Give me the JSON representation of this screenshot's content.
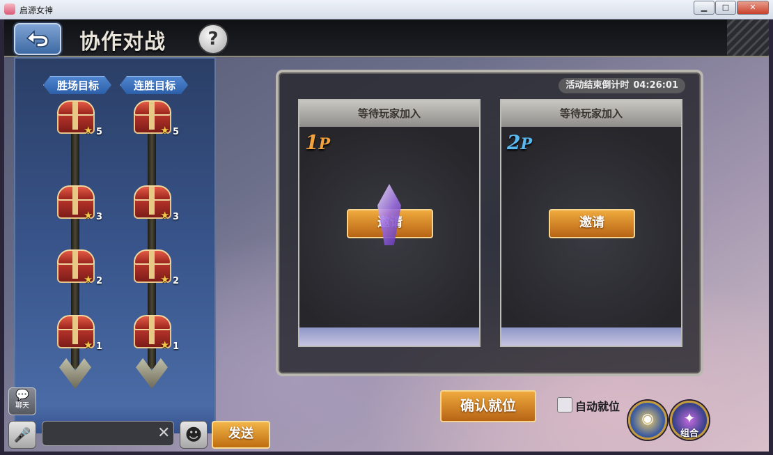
{
  "window": {
    "title": "启源女神",
    "minimize": "▁",
    "maximize": "□",
    "close": "✕"
  },
  "header": {
    "title": "协作对战",
    "help": "?"
  },
  "rewards": {
    "win_target_label": "胜场目标",
    "streak_target_label": "连胜目标",
    "win_targets": [
      "5",
      "3",
      "2",
      "1"
    ],
    "streak_targets": [
      "5",
      "3",
      "2",
      "1"
    ],
    "star": "★"
  },
  "panel": {
    "countdown_label": "活动结束倒计时",
    "countdown_value": "04:26:01",
    "slots": [
      {
        "title": "等待玩家加入",
        "badge_num": "1",
        "badge_p": "P",
        "invite": "邀请"
      },
      {
        "title": "等待玩家加入",
        "badge_num": "2",
        "badge_p": "P",
        "invite": "邀请"
      }
    ]
  },
  "actions": {
    "confirm": "确认就位",
    "auto_ready": "自动就位",
    "combo": "组合"
  },
  "chat": {
    "chat_label": "聊天",
    "chat_glyph": "💬",
    "input_value": "",
    "clear": "✕",
    "send": "发送"
  }
}
